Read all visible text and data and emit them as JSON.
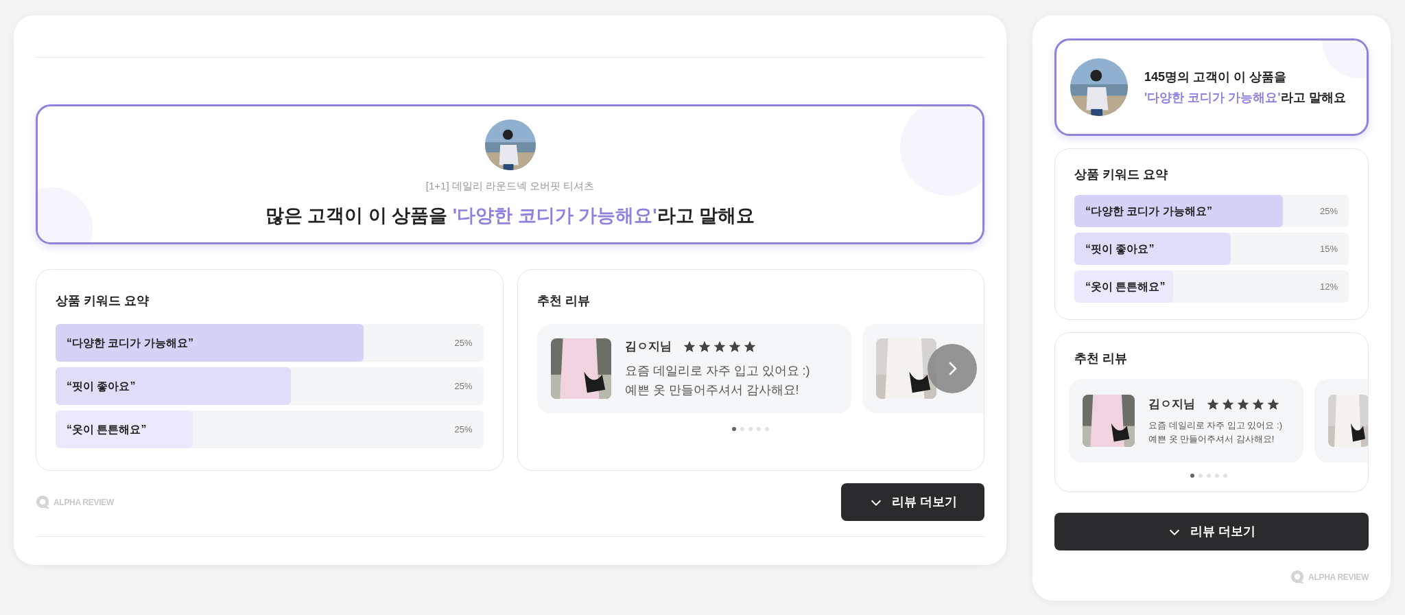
{
  "desktop_widget": {
    "hero": {
      "product_name": "[1+1] 데일리 라운드넥 오버핏 티셔츠",
      "before": "많은 고객이 이 상품을 ",
      "highlight": "'다양한 코디가 가능해요'",
      "after": "라고 말해요"
    },
    "keywords": {
      "title": "상품 키워드 요약",
      "items": [
        {
          "label": "“다양한 코디가 가능해요”",
          "percent": "25%",
          "level": 0.72
        },
        {
          "label": "“핏이 좋아요”",
          "percent": "25%",
          "level": 0.55
        },
        {
          "label": "“옷이 튼튼해요”",
          "percent": "25%",
          "level": 0.32
        }
      ]
    },
    "reviews": {
      "title": "추천 리뷰",
      "items": [
        {
          "author": "김ㅇ지님",
          "stars": 5,
          "text": "요즘 데일리로 자주 입고 있어요 :) 예쁜 옷 만들어주셔서 감사해요!"
        }
      ],
      "dots": [
        {
          "selected": true
        },
        {
          "selected": false
        },
        {
          "selected": false
        },
        {
          "selected": false
        },
        {
          "selected": false
        }
      ]
    },
    "brand": "ALPHA REVIEW",
    "more_button": "리뷰 더보기"
  },
  "mobile_widget": {
    "hero": {
      "before": "145명의 고객이 이 상품을",
      "highlight": "'다양한 코디가 가능해요'",
      "after": "라고 말해요"
    },
    "keywords": {
      "title": "상품 키워드 요약",
      "items": [
        {
          "label": "“다양한 코디가 가능해요”",
          "percent": "25%",
          "level": 0.76
        },
        {
          "label": "“핏이 좋아요”",
          "percent": "15%",
          "level": 0.57
        },
        {
          "label": "“옷이 튼튼해요”",
          "percent": "12%",
          "level": 0.36
        }
      ]
    },
    "reviews": {
      "title": "추천 리뷰",
      "items": [
        {
          "author": "김ㅇ지님",
          "stars": 5,
          "text": "요즘 데일리로 자주 입고 있어요 :) 예쁜 옷 만들어주셔서 감사해요!"
        }
      ],
      "dots": [
        {
          "selected": true
        },
        {
          "selected": false
        },
        {
          "selected": false
        },
        {
          "selected": false
        },
        {
          "selected": false
        }
      ]
    },
    "more_button": "리뷰 더보기",
    "brand": "ALPHA REVIEW"
  }
}
